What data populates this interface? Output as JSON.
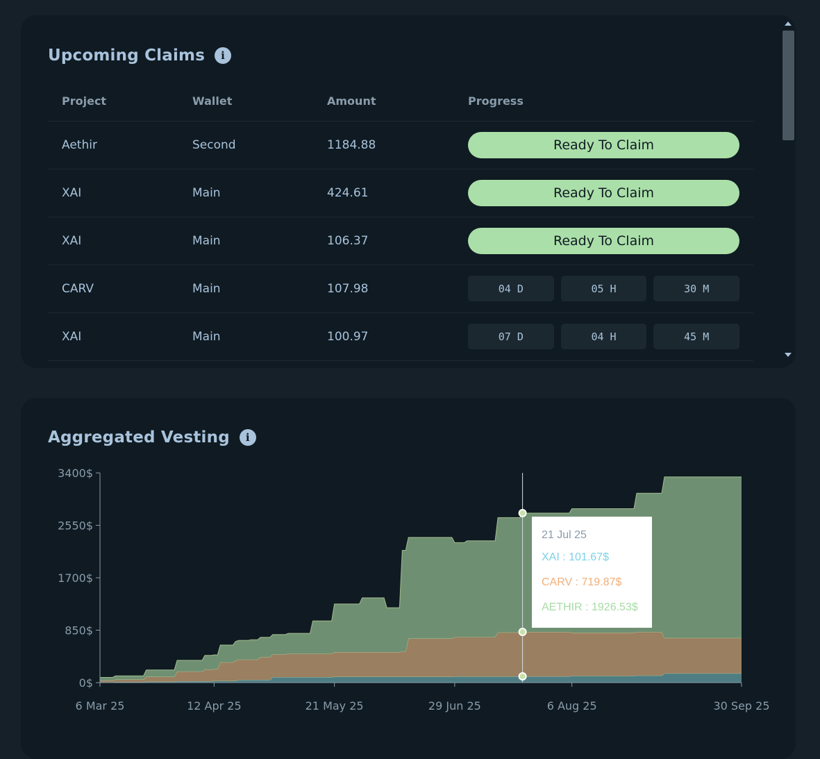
{
  "claims": {
    "title": "Upcoming Claims",
    "columns": [
      "Project",
      "Wallet",
      "Amount",
      "Progress"
    ],
    "rows": [
      {
        "project": "Aethir",
        "wallet": "Second",
        "amount": "1184.88",
        "status": "Ready To Claim"
      },
      {
        "project": "XAI",
        "wallet": "Main",
        "amount": "424.61",
        "status": "Ready To Claim"
      },
      {
        "project": "XAI",
        "wallet": "Main",
        "amount": "106.37",
        "status": "Ready To Claim"
      },
      {
        "project": "CARV",
        "wallet": "Main",
        "amount": "107.98",
        "timer": [
          "04 D",
          "05 H",
          "30 M"
        ]
      },
      {
        "project": "XAI",
        "wallet": "Main",
        "amount": "100.97",
        "timer": [
          "07 D",
          "04 H",
          "45 M"
        ]
      }
    ]
  },
  "vesting": {
    "title": "Aggregated Vesting",
    "tooltip": {
      "date": "21 Jul 25",
      "xai": "XAI : 101.67$",
      "carv": "CARV : 719.87$",
      "aethir": "AETHIR : 1926.53$"
    }
  },
  "colors": {
    "aethir": "#6f8f72",
    "carv": "#9a7f61",
    "xai": "#4f7d84",
    "claim_button": "#abdfa9",
    "tooltip_xai": "#7cd1e6",
    "tooltip_carv": "#f2ae78",
    "tooltip_aethir": "#a7dca4"
  },
  "chart_data": {
    "type": "area",
    "stacked": true,
    "x_axis_type": "date",
    "x_range": [
      "2025-03-06",
      "2025-09-30"
    ],
    "x_ticks": [
      {
        "date": "2025-03-06",
        "label": "6 Mar 25"
      },
      {
        "date": "2025-04-12",
        "label": "12 Apr 25"
      },
      {
        "date": "2025-05-21",
        "label": "21 May 25"
      },
      {
        "date": "2025-06-29",
        "label": "29 Jun 25"
      },
      {
        "date": "2025-08-06",
        "label": "6 Aug 25"
      },
      {
        "date": "2025-09-30",
        "label": "30 Sep 25"
      }
    ],
    "y_ticks": [
      0,
      850,
      1700,
      2550,
      3400
    ],
    "y_tick_labels": [
      "0$",
      "850$",
      "1700$",
      "2550$",
      "3400$"
    ],
    "ylim": [
      0,
      3400
    ],
    "highlight_date": "2025-07-21",
    "series": [
      {
        "name": "XAI",
        "points": [
          [
            "2025-03-06",
            5
          ],
          [
            "2025-03-11",
            10
          ],
          [
            "2025-03-21",
            15
          ],
          [
            "2025-03-31",
            22
          ],
          [
            "2025-04-12",
            30
          ],
          [
            "2025-04-20",
            45
          ],
          [
            "2025-05-01",
            90
          ],
          [
            "2025-05-21",
            95
          ],
          [
            "2025-06-14",
            95
          ],
          [
            "2025-06-29",
            100
          ],
          [
            "2025-07-21",
            101.67
          ],
          [
            "2025-08-06",
            110
          ],
          [
            "2025-08-27",
            115
          ],
          [
            "2025-09-05",
            150
          ],
          [
            "2025-09-30",
            150
          ]
        ]
      },
      {
        "name": "CARV",
        "points": [
          [
            "2025-03-06",
            30
          ],
          [
            "2025-03-11",
            40
          ],
          [
            "2025-03-21",
            80
          ],
          [
            "2025-03-31",
            160
          ],
          [
            "2025-04-09",
            190
          ],
          [
            "2025-04-14",
            300
          ],
          [
            "2025-04-19",
            330
          ],
          [
            "2025-04-27",
            370
          ],
          [
            "2025-05-06",
            380
          ],
          [
            "2025-05-21",
            400
          ],
          [
            "2025-06-12",
            410
          ],
          [
            "2025-06-14",
            620
          ],
          [
            "2025-06-29",
            640
          ],
          [
            "2025-07-13",
            715
          ],
          [
            "2025-07-21",
            719.87
          ],
          [
            "2025-08-06",
            700
          ],
          [
            "2025-08-27",
            705
          ],
          [
            "2025-09-05",
            575
          ],
          [
            "2025-09-30",
            575
          ]
        ]
      },
      {
        "name": "AETHIR",
        "points": [
          [
            "2025-03-06",
            50
          ],
          [
            "2025-03-11",
            60
          ],
          [
            "2025-03-21",
            110
          ],
          [
            "2025-03-31",
            180
          ],
          [
            "2025-04-09",
            230
          ],
          [
            "2025-04-14",
            280
          ],
          [
            "2025-04-19",
            310
          ],
          [
            "2025-04-24",
            320
          ],
          [
            "2025-05-06",
            330
          ],
          [
            "2025-05-14",
            530
          ],
          [
            "2025-05-21",
            780
          ],
          [
            "2025-05-30",
            880
          ],
          [
            "2025-06-07",
            720
          ],
          [
            "2025-06-12",
            1640
          ],
          [
            "2025-06-29",
            1530
          ],
          [
            "2025-07-03",
            1560
          ],
          [
            "2025-07-13",
            1860
          ],
          [
            "2025-07-21",
            1926.53
          ],
          [
            "2025-08-06",
            2010
          ],
          [
            "2025-08-27",
            2250
          ],
          [
            "2025-09-05",
            2610
          ],
          [
            "2025-09-30",
            2610
          ]
        ]
      }
    ]
  }
}
